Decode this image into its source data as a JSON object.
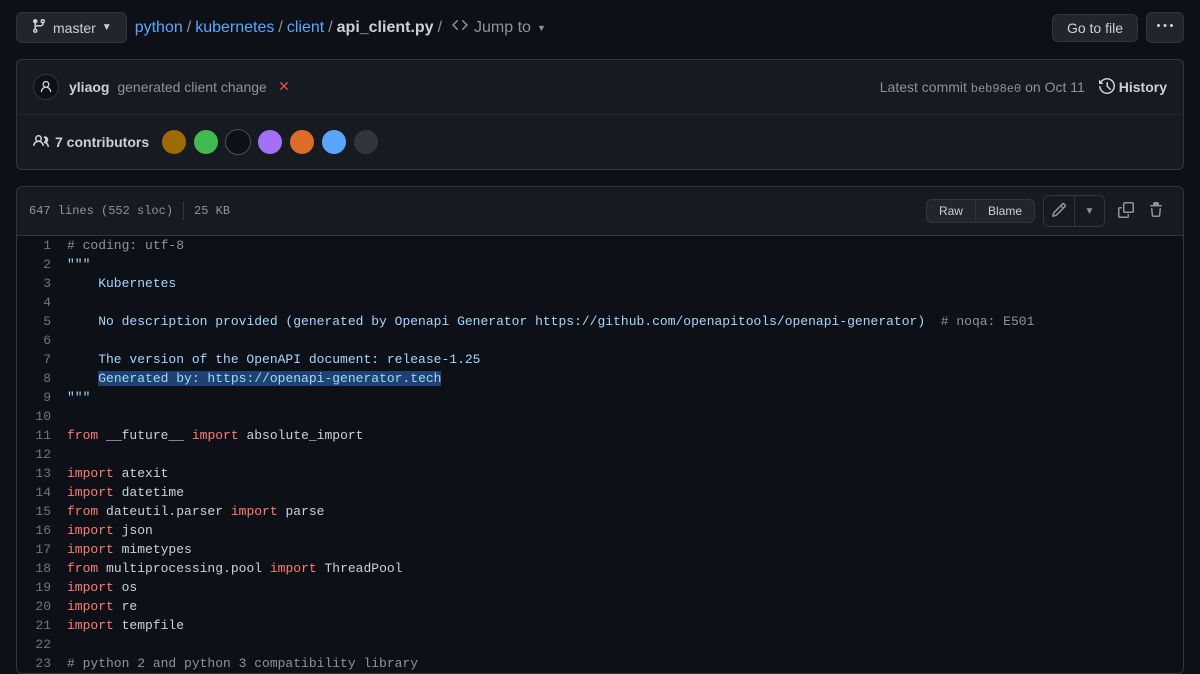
{
  "branch": {
    "name": "master"
  },
  "breadcrumb": {
    "parts": [
      "python",
      "kubernetes",
      "client"
    ],
    "file": "api_client.py",
    "jump_label": "Jump to"
  },
  "topbar": {
    "go_to_file": "Go to file"
  },
  "commit": {
    "author": "yliaog",
    "message": "generated client change",
    "latest_label": "Latest commit",
    "hash": "beb98e0",
    "date_prefix": "on",
    "date": "Oct 11",
    "history_label": "History"
  },
  "contributors": {
    "count_label": "7 contributors",
    "avatars": 7
  },
  "file": {
    "lines": "647 lines (552 sloc)",
    "size": "25 KB",
    "raw": "Raw",
    "blame": "Blame"
  },
  "code": [
    {
      "n": 1,
      "tokens": [
        [
          "cmt",
          "# coding: utf-8"
        ]
      ]
    },
    {
      "n": 2,
      "tokens": [
        [
          "str",
          "\"\"\""
        ]
      ]
    },
    {
      "n": 3,
      "tokens": [
        [
          "str",
          "    Kubernetes"
        ]
      ]
    },
    {
      "n": 4,
      "tokens": []
    },
    {
      "n": 5,
      "tokens": [
        [
          "str",
          "    No description provided (generated by Openapi Generator https://github.com/openapitools/openapi-generator)  "
        ],
        [
          "cmt",
          "# noqa: E501"
        ]
      ]
    },
    {
      "n": 6,
      "tokens": []
    },
    {
      "n": 7,
      "tokens": [
        [
          "str",
          "    The version of the OpenAPI document: release-1.25"
        ]
      ]
    },
    {
      "n": 8,
      "tokens": [
        [
          "str",
          "    "
        ],
        [
          "hl",
          "Generated by: https://openapi-generator.tech"
        ]
      ]
    },
    {
      "n": 9,
      "tokens": [
        [
          "str",
          "\"\"\""
        ]
      ]
    },
    {
      "n": 10,
      "tokens": []
    },
    {
      "n": 11,
      "tokens": [
        [
          "kw",
          "from"
        ],
        [
          "mod",
          " __future__ "
        ],
        [
          "kw",
          "import"
        ],
        [
          "mod",
          " absolute_import"
        ]
      ]
    },
    {
      "n": 12,
      "tokens": []
    },
    {
      "n": 13,
      "tokens": [
        [
          "kw",
          "import"
        ],
        [
          "mod",
          " atexit"
        ]
      ]
    },
    {
      "n": 14,
      "tokens": [
        [
          "kw",
          "import"
        ],
        [
          "mod",
          " datetime"
        ]
      ]
    },
    {
      "n": 15,
      "tokens": [
        [
          "kw",
          "from"
        ],
        [
          "mod",
          " dateutil.parser "
        ],
        [
          "kw",
          "import"
        ],
        [
          "mod",
          " parse"
        ]
      ]
    },
    {
      "n": 16,
      "tokens": [
        [
          "kw",
          "import"
        ],
        [
          "mod",
          " json"
        ]
      ]
    },
    {
      "n": 17,
      "tokens": [
        [
          "kw",
          "import"
        ],
        [
          "mod",
          " mimetypes"
        ]
      ]
    },
    {
      "n": 18,
      "tokens": [
        [
          "kw",
          "from"
        ],
        [
          "mod",
          " multiprocessing.pool "
        ],
        [
          "kw",
          "import"
        ],
        [
          "mod",
          " ThreadPool"
        ]
      ]
    },
    {
      "n": 19,
      "tokens": [
        [
          "kw",
          "import"
        ],
        [
          "mod",
          " os"
        ]
      ]
    },
    {
      "n": 20,
      "tokens": [
        [
          "kw",
          "import"
        ],
        [
          "mod",
          " re"
        ]
      ]
    },
    {
      "n": 21,
      "tokens": [
        [
          "kw",
          "import"
        ],
        [
          "mod",
          " tempfile"
        ]
      ]
    },
    {
      "n": 22,
      "tokens": []
    },
    {
      "n": 23,
      "tokens": [
        [
          "cmt",
          "# python 2 and python 3 compatibility library"
        ]
      ]
    }
  ]
}
